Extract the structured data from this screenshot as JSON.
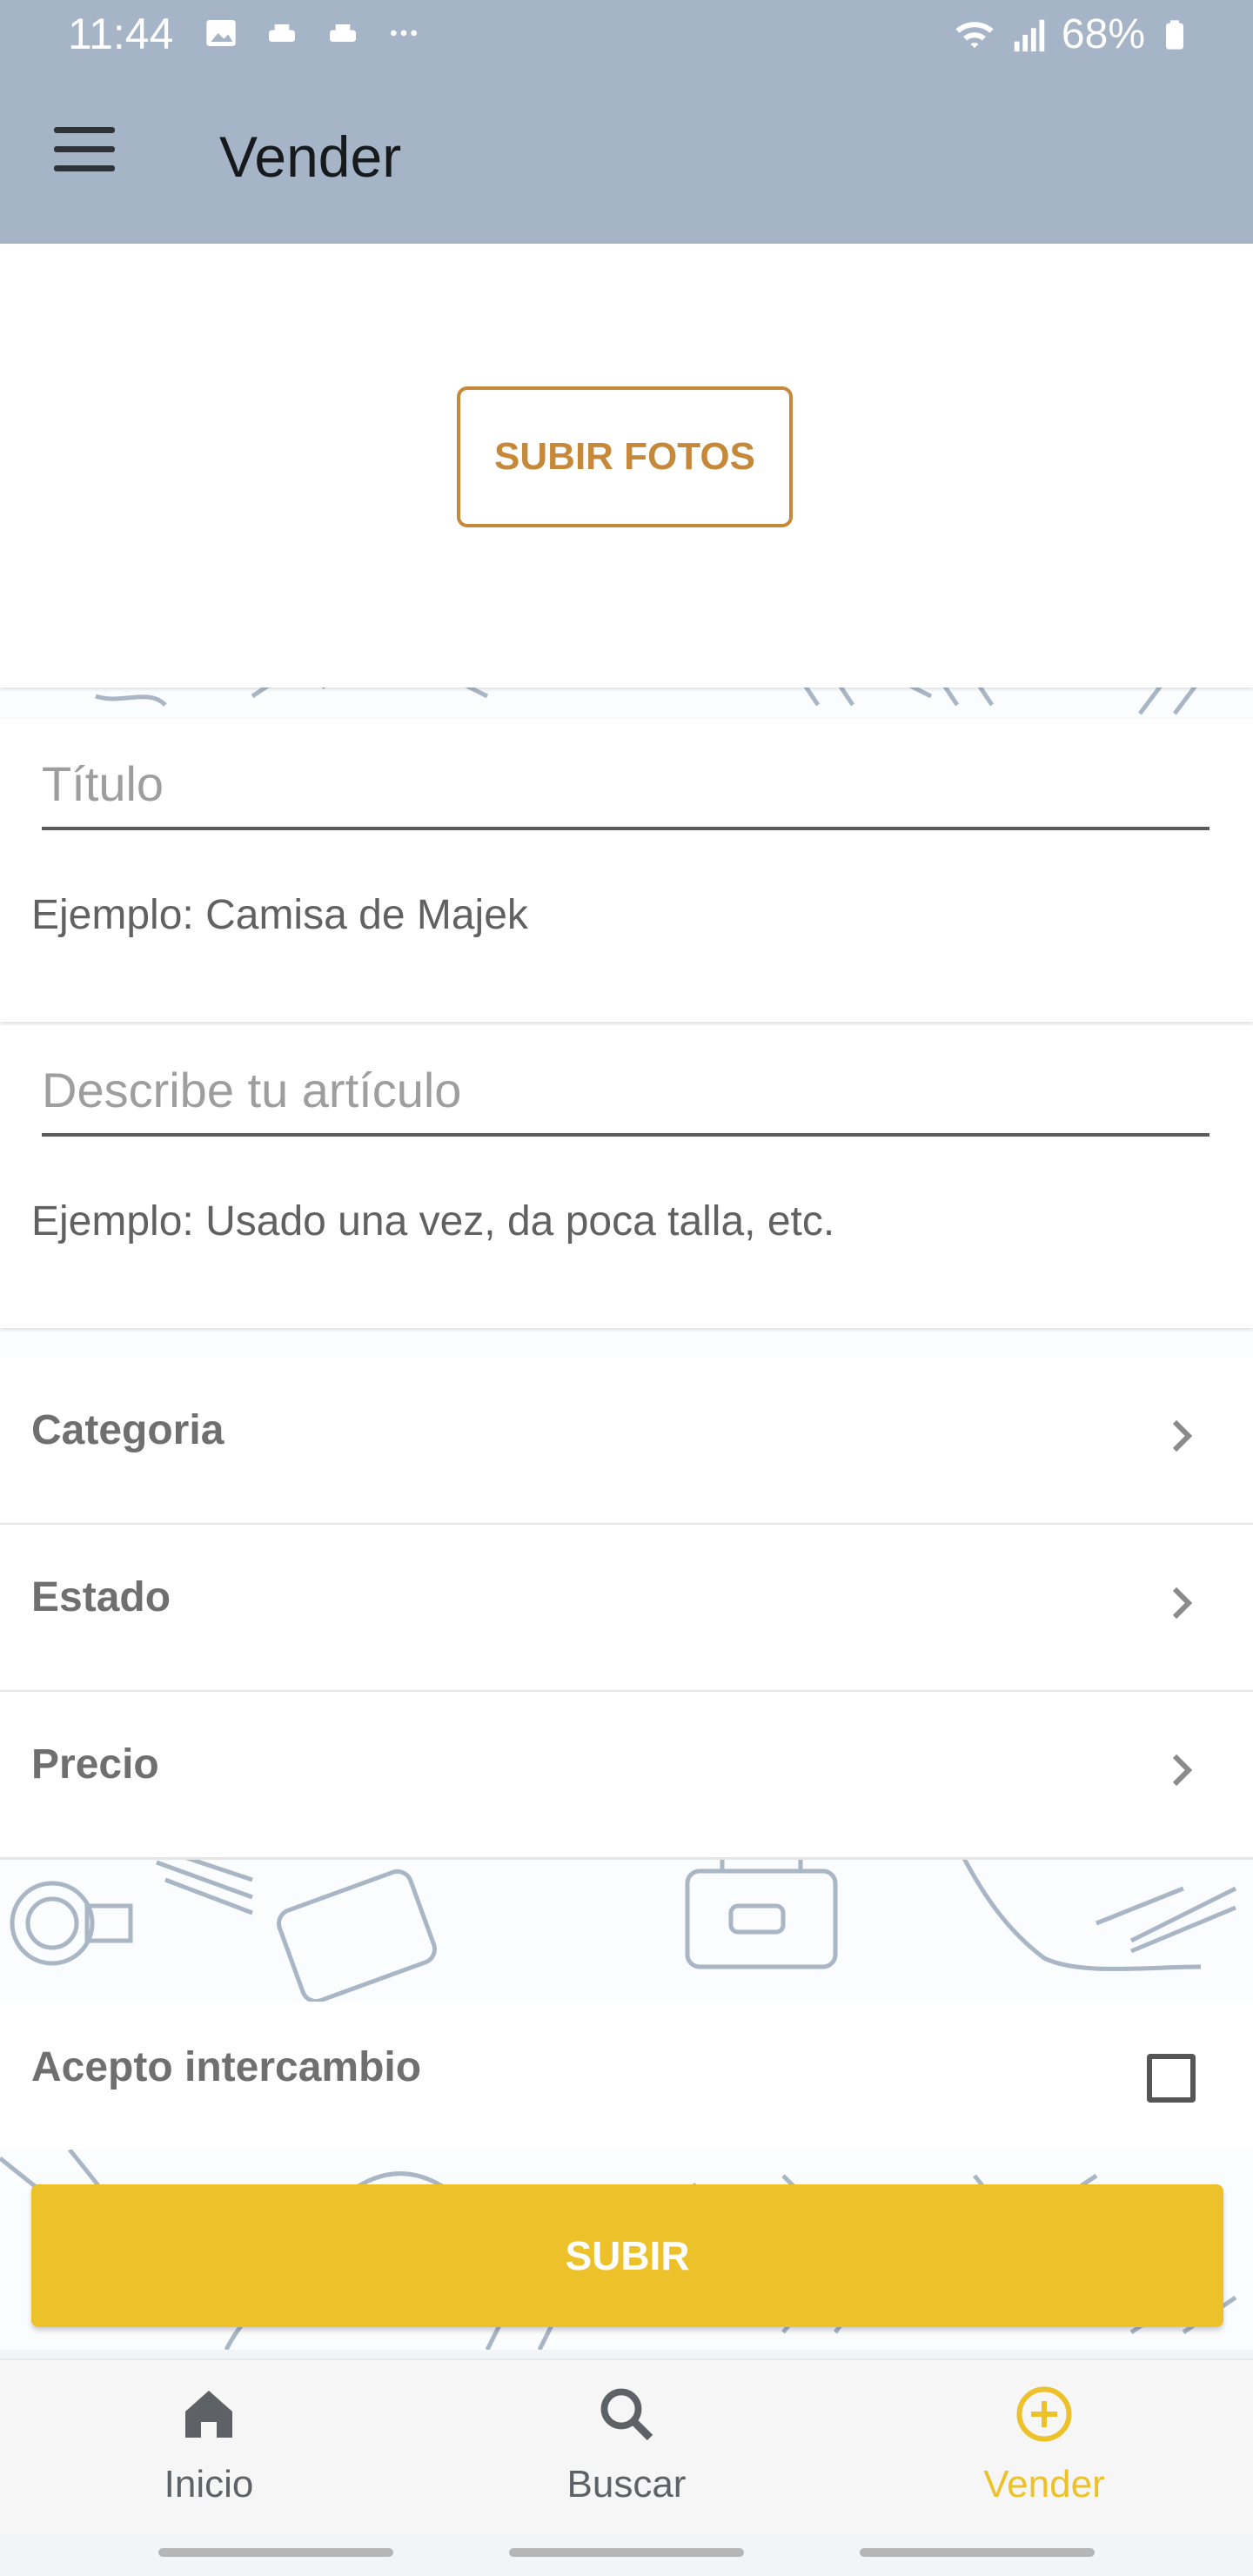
{
  "status_bar": {
    "time": "11:44",
    "battery": "68%",
    "left_icons": [
      "image-icon",
      "notification-icon",
      "notification-icon",
      "more-icon"
    ],
    "right_icons": [
      "wifi-icon",
      "signal-icon",
      "battery-icon"
    ]
  },
  "app_bar": {
    "title": "Vender",
    "menu_icon": "menu-icon"
  },
  "photos": {
    "upload_label": "SUBIR FOTOS"
  },
  "form": {
    "title_placeholder": "Título",
    "title_hint": "Ejemplo: Camisa de Majek",
    "description_placeholder": "Describe tu artículo",
    "description_hint": "Ejemplo: Usado una vez, da poca talla, etc.",
    "rows": [
      {
        "label": "Categoria",
        "icon": "chevron-right-icon"
      },
      {
        "label": "Estado",
        "icon": "chevron-right-icon"
      },
      {
        "label": "Precio",
        "icon": "chevron-right-icon"
      }
    ],
    "swap_label": "Acepto intercambio",
    "swap_checked": false,
    "submit_label": "SUBIR"
  },
  "bottom_nav": {
    "items": [
      {
        "label": "Inicio",
        "icon": "home-icon",
        "active": false
      },
      {
        "label": "Buscar",
        "icon": "search-icon",
        "active": false
      },
      {
        "label": "Vender",
        "icon": "plus-circle-icon",
        "active": true
      }
    ]
  },
  "colors": {
    "app_bar": "#a5b4c7",
    "accent": "#edc12a",
    "upload_border": "#c6893a"
  }
}
